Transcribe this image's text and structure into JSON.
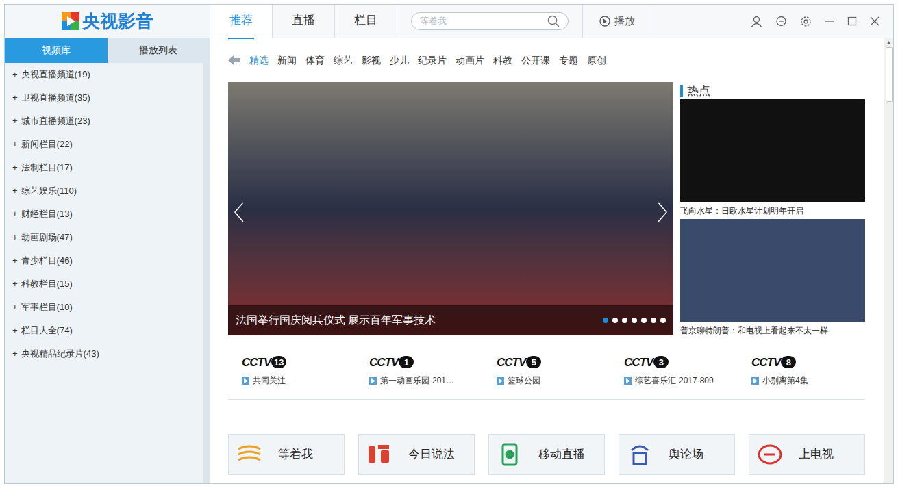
{
  "window": {
    "app_name": "央视影音"
  },
  "top_tabs": [
    {
      "label": "推荐",
      "selected": true
    },
    {
      "label": "直播",
      "selected": false
    },
    {
      "label": "栏目",
      "selected": false
    }
  ],
  "search": {
    "placeholder": "等着我"
  },
  "play_button": {
    "label": "播放"
  },
  "sidebar": {
    "tabs": [
      {
        "label": "视频库",
        "selected": true
      },
      {
        "label": "播放列表",
        "selected": false
      }
    ],
    "items": [
      {
        "expander": "+",
        "label": "央视直播频道",
        "count": "(19)"
      },
      {
        "expander": "+",
        "label": "卫视直播频道",
        "count": "(35)"
      },
      {
        "expander": "+",
        "label": "城市直播频道",
        "count": "(23)"
      },
      {
        "expander": "+",
        "label": "新闻栏目",
        "count": "(22)"
      },
      {
        "expander": "+",
        "label": "法制栏目",
        "count": "(17)"
      },
      {
        "expander": "+",
        "label": "综艺娱乐",
        "count": "(110)"
      },
      {
        "expander": "+",
        "label": "财经栏目",
        "count": "(13)"
      },
      {
        "expander": "+",
        "label": "动画剧场",
        "count": "(47)"
      },
      {
        "expander": "+",
        "label": "青少栏目",
        "count": "(46)"
      },
      {
        "expander": "+",
        "label": "科教栏目",
        "count": "(15)"
      },
      {
        "expander": "+",
        "label": "军事栏目",
        "count": "(10)"
      },
      {
        "expander": "+",
        "label": "栏目大全",
        "count": "(74)"
      },
      {
        "expander": "+",
        "label": "央视精品纪录片",
        "count": "(43)"
      }
    ]
  },
  "categories": [
    {
      "label": "精选",
      "selected": true
    },
    {
      "label": "新闻",
      "selected": false
    },
    {
      "label": "体育",
      "selected": false
    },
    {
      "label": "综艺",
      "selected": false
    },
    {
      "label": "影视",
      "selected": false
    },
    {
      "label": "少儿",
      "selected": false
    },
    {
      "label": "纪录片",
      "selected": false
    },
    {
      "label": "动画片",
      "selected": false
    },
    {
      "label": "科教",
      "selected": false
    },
    {
      "label": "公开课",
      "selected": false
    },
    {
      "label": "专题",
      "selected": false
    },
    {
      "label": "原创",
      "selected": false
    }
  ],
  "carousel": {
    "caption": "法国举行国庆阅兵仪式 展示百年军事技术",
    "dots": [
      {
        "selected": true
      },
      {
        "selected": false
      },
      {
        "selected": false
      },
      {
        "selected": false
      },
      {
        "selected": false
      },
      {
        "selected": false
      },
      {
        "selected": false
      }
    ]
  },
  "hot": {
    "title": "热点",
    "items": [
      {
        "caption": "飞向水星：日欧水星计划明年开启"
      },
      {
        "caption": "普京聊特朗普：和电视上看起来不太一样"
      }
    ]
  },
  "channels": [
    {
      "logo": "CCTV",
      "number": "13",
      "program": "共同关注"
    },
    {
      "logo": "CCTV",
      "number": "1",
      "program": "第一动画乐园-201…"
    },
    {
      "logo": "CCTV",
      "number": "5",
      "program": "篮球公园"
    },
    {
      "logo": "CCTV",
      "number": "3",
      "program": "综艺喜乐汇-2017-809"
    },
    {
      "logo": "CCTV",
      "number": "8",
      "program": "小别离第4集"
    }
  ],
  "shortcuts": [
    {
      "label": "等着我",
      "color": "#f0a020"
    },
    {
      "label": "今日说法",
      "color": "#d8432f"
    },
    {
      "label": "移动直播",
      "color": "#2aa35a"
    },
    {
      "label": "舆论场",
      "color": "#3b5bb0"
    },
    {
      "label": "上电视",
      "color": "#d8332f"
    }
  ]
}
